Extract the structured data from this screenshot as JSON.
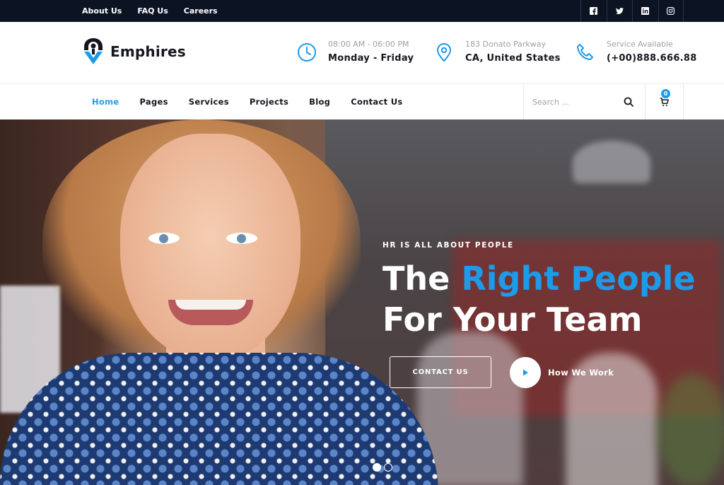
{
  "topbar": {
    "links": [
      "About Us",
      "FAQ Us",
      "Careers"
    ],
    "socials": [
      "facebook-icon",
      "twitter-icon",
      "linkedin-icon",
      "instagram-icon"
    ]
  },
  "brand": {
    "name": "Emphires",
    "accent_color": "#1e9be8",
    "dark_color": "#0c1424"
  },
  "header_info": {
    "hours": {
      "label": "08:00 AM - 06:00 PM",
      "value": "Monday - Friday",
      "icon": "clock-icon"
    },
    "address": {
      "label": "183 Donato Parkway",
      "value": "CA, United States",
      "icon": "map-pin-icon"
    },
    "phone": {
      "label": "Service Available",
      "value": "(+00)888.666.88",
      "icon": "phone-icon"
    }
  },
  "nav": {
    "items": [
      "Home",
      "Pages",
      "Services",
      "Projects",
      "Blog",
      "Contact Us"
    ],
    "active": "Home"
  },
  "search": {
    "placeholder": "Search ..."
  },
  "cart": {
    "count": "0"
  },
  "hero": {
    "eyebrow": "HR IS ALL ABOUT PEOPLE",
    "headline_part1": "The ",
    "headline_accent": "Right People",
    "headline_line2": "For Your Team",
    "cta_label": "CONTACT US",
    "video_label": "How We Work",
    "slides_total": 2,
    "active_slide": 1
  }
}
